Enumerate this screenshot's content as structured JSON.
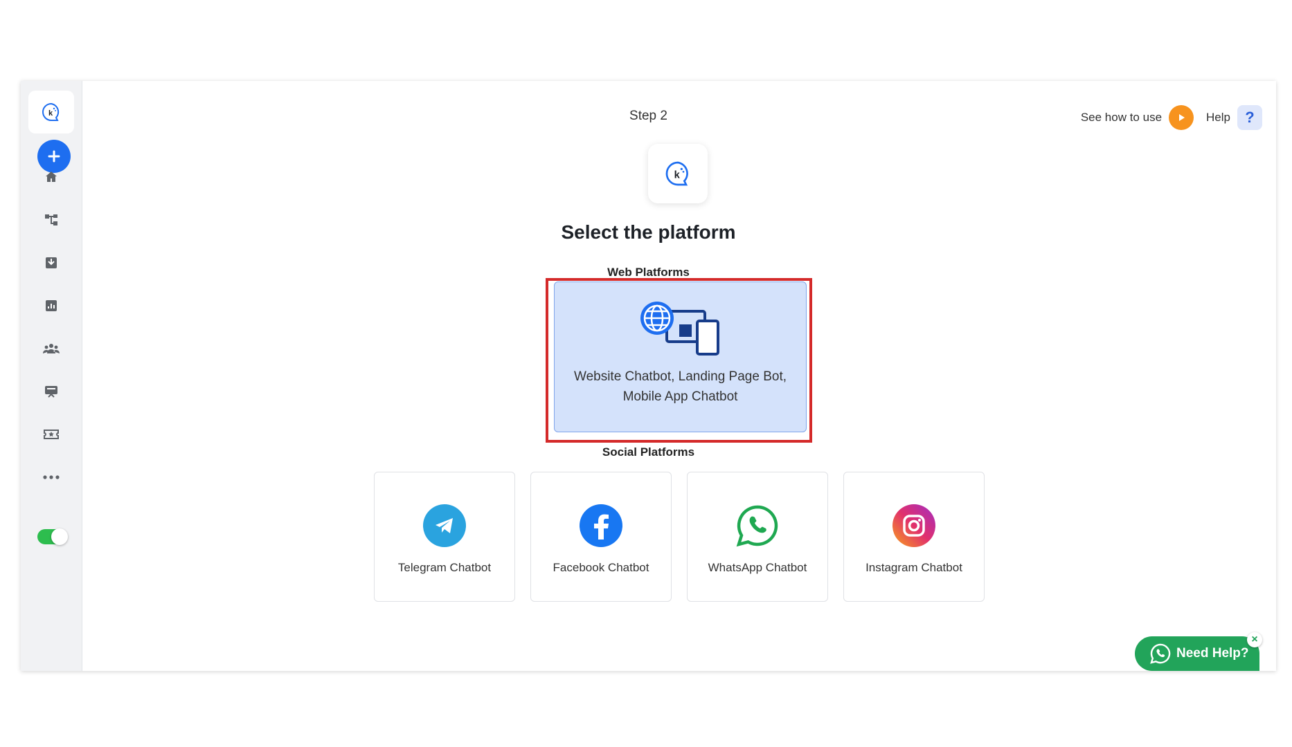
{
  "sidebar": {
    "logo_icon": "kommunicate-logo-icon",
    "add_icon": "plus-icon",
    "items": [
      {
        "icon": "home-icon"
      },
      {
        "icon": "workflow-icon"
      },
      {
        "icon": "inbox-icon"
      },
      {
        "icon": "analytics-icon"
      },
      {
        "icon": "users-icon"
      },
      {
        "icon": "integrations-icon"
      },
      {
        "icon": "tickets-icon"
      },
      {
        "icon": "more-icon"
      }
    ],
    "toggle_on": true
  },
  "header": {
    "step": "Step 2",
    "see_how_label": "See how to use",
    "help_label": "Help",
    "help_glyph": "?"
  },
  "main": {
    "title": "Select the platform",
    "web_section": "Web Platforms",
    "web_card_label": "Website Chatbot, Landing Page Bot, Mobile App Chatbot",
    "social_section": "Social Platforms",
    "social_cards": [
      {
        "label": "Telegram Chatbot",
        "icon": "telegram-icon",
        "color": "#2aa3df"
      },
      {
        "label": "Facebook Chatbot",
        "icon": "facebook-icon",
        "color": "#1877f2"
      },
      {
        "label": "WhatsApp Chatbot",
        "icon": "whatsapp-icon",
        "color": "#1fa851"
      },
      {
        "label": "Instagram Chatbot",
        "icon": "instagram-icon",
        "color": "#e1306c"
      }
    ]
  },
  "widget": {
    "need_help_label": "Need Help?",
    "close_glyph": "×"
  },
  "colors": {
    "accent": "#1e6ef0",
    "highlight": "#d42a2a",
    "web_card_bg": "#d4e2fb",
    "whatsapp_green": "#22a45a",
    "play_orange": "#f7931e"
  }
}
